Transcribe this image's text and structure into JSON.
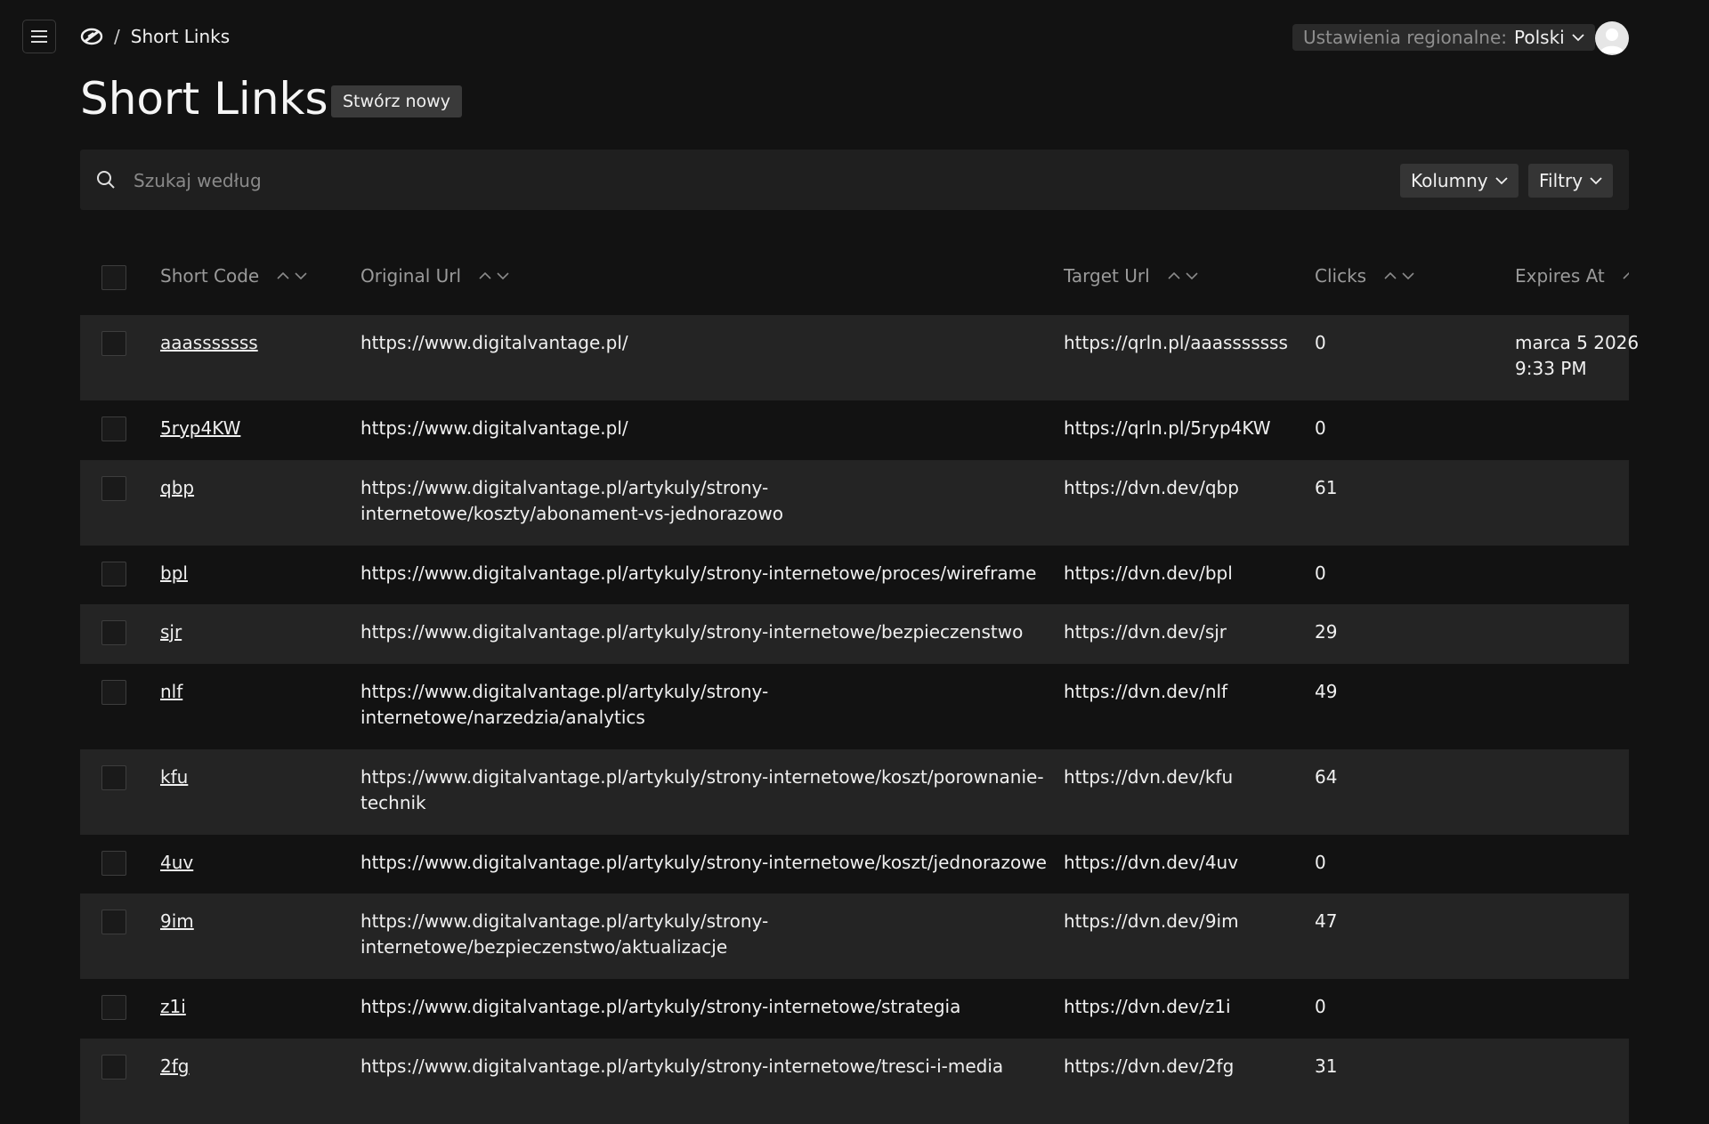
{
  "header": {
    "breadcrumb_sep": "/",
    "breadcrumb_current": "Short Links",
    "locale_label": "Ustawienia regionalne:",
    "locale_value": "Polski"
  },
  "page": {
    "title": "Short Links",
    "create_label": "Stwórz nowy"
  },
  "toolbar": {
    "search_placeholder": "Szukaj według",
    "columns_label": "Kolumny",
    "filters_label": "Filtry"
  },
  "table": {
    "columns": [
      "Short Code",
      "Original Url",
      "Target Url",
      "Clicks",
      "Expires At"
    ],
    "rows": [
      {
        "code": "aaasssssss",
        "original": "https://www.digitalvantage.pl/",
        "target": "https://qrln.pl/aaasssssss",
        "clicks": "0",
        "expires": "marca 5 2026 9:33 PM"
      },
      {
        "code": "5ryp4KW",
        "original": "https://www.digitalvantage.pl/",
        "target": "https://qrln.pl/5ryp4KW",
        "clicks": "0",
        "expires": ""
      },
      {
        "code": "qbp",
        "original": "https://www.digitalvantage.pl/artykuly/strony-internetowe/koszty/abonament-vs-jednorazowo",
        "target": "https://dvn.dev/qbp",
        "clicks": "61",
        "expires": ""
      },
      {
        "code": "bpl",
        "original": "https://www.digitalvantage.pl/artykuly/strony-internetowe/proces/wireframe",
        "target": "https://dvn.dev/bpl",
        "clicks": "0",
        "expires": ""
      },
      {
        "code": "sjr",
        "original": "https://www.digitalvantage.pl/artykuly/strony-internetowe/bezpieczenstwo",
        "target": "https://dvn.dev/sjr",
        "clicks": "29",
        "expires": ""
      },
      {
        "code": "nlf",
        "original": "https://www.digitalvantage.pl/artykuly/strony-internetowe/narzedzia/analytics",
        "target": "https://dvn.dev/nlf",
        "clicks": "49",
        "expires": ""
      },
      {
        "code": "kfu",
        "original": "https://www.digitalvantage.pl/artykuly/strony-internetowe/koszt/porownanie-technik",
        "target": "https://dvn.dev/kfu",
        "clicks": "64",
        "expires": ""
      },
      {
        "code": "4uv",
        "original": "https://www.digitalvantage.pl/artykuly/strony-internetowe/koszt/jednorazowe",
        "target": "https://dvn.dev/4uv",
        "clicks": "0",
        "expires": ""
      },
      {
        "code": "9im",
        "original": "https://www.digitalvantage.pl/artykuly/strony-internetowe/bezpieczenstwo/aktualizacje",
        "target": "https://dvn.dev/9im",
        "clicks": "47",
        "expires": ""
      },
      {
        "code": "z1i",
        "original": "https://www.digitalvantage.pl/artykuly/strony-internetowe/strategia",
        "target": "https://dvn.dev/z1i",
        "clicks": "0",
        "expires": ""
      },
      {
        "code": "2fg",
        "original": "https://www.digitalvantage.pl/artykuly/strony-internetowe/tresci-i-media",
        "target": "https://dvn.dev/2fg",
        "clicks": "31",
        "expires": ""
      }
    ]
  }
}
